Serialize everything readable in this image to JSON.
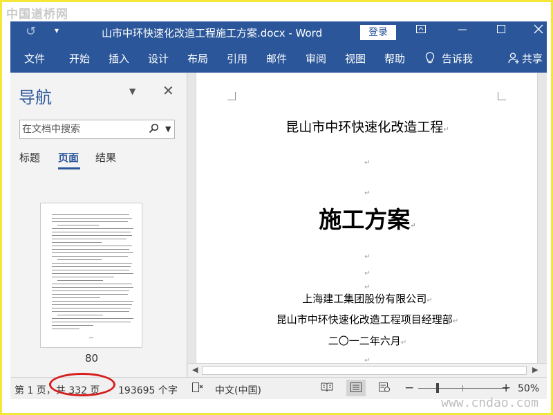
{
  "watermarks": {
    "top_left": "中国道桥网",
    "bottom_right": "www.cndao.com"
  },
  "titlebar": {
    "title": "山市中环快速化改造工程施工方案.docx  -  Word",
    "login": "登录",
    "icons": [
      "undo-icon",
      "customize-qa-icon",
      "ribbon-display-icon",
      "minimize-icon",
      "maximize-icon",
      "close-icon"
    ]
  },
  "ribbon": {
    "tabs": [
      "文件",
      "开始",
      "插入",
      "设计",
      "布局",
      "引用",
      "邮件",
      "审阅",
      "视图",
      "帮助"
    ],
    "tell_me": "告诉我",
    "share": "共享"
  },
  "nav": {
    "title": "导航",
    "search_placeholder": "在文档中搜索",
    "tabs": [
      "标题",
      "页面",
      "结果"
    ],
    "active_tab": "页面",
    "thumbnail_page": "80"
  },
  "document": {
    "heading": "昆山市中环快速化改造工程",
    "main_title": "施工方案",
    "company": "上海建工集团股份有限公司",
    "department": "昆山市中环快速化改造工程项目经理部",
    "date": "二〇一二年六月",
    "paragraph_mark": "↵"
  },
  "statusbar": {
    "page": "第 1 页，共 332 页",
    "words": "193695 个字",
    "language": "中文(中国)",
    "zoom": "50%",
    "zoom_level": 0.5,
    "zoom_minus": "−",
    "zoom_plus": "+"
  }
}
